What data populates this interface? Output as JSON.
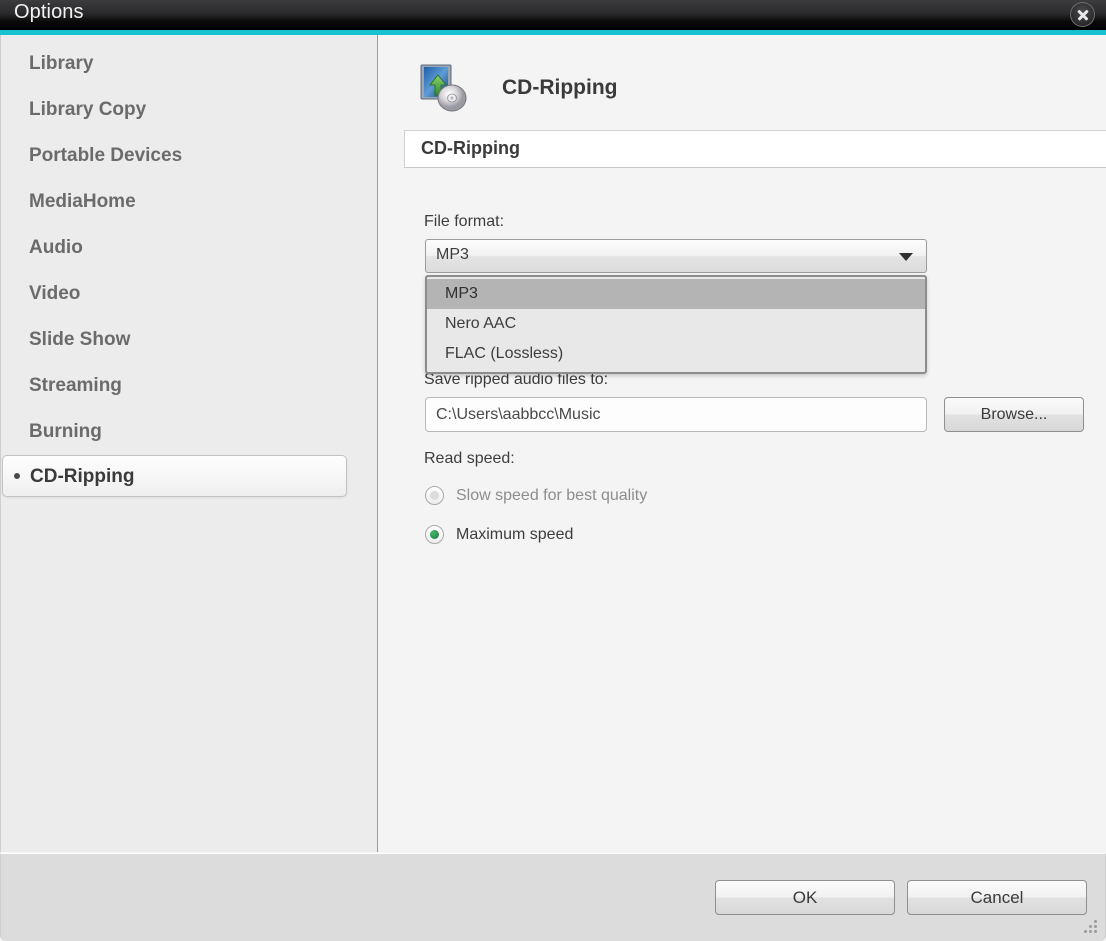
{
  "window": {
    "title": "Options",
    "close_icon": "close-icon",
    "accent_color": "#17c1cf"
  },
  "sidebar": {
    "items": [
      {
        "label": "Library",
        "selected": false
      },
      {
        "label": "Library Copy",
        "selected": false
      },
      {
        "label": "Portable Devices",
        "selected": false
      },
      {
        "label": "MediaHome",
        "selected": false
      },
      {
        "label": "Audio",
        "selected": false
      },
      {
        "label": "Video",
        "selected": false
      },
      {
        "label": "Slide Show",
        "selected": false
      },
      {
        "label": "Streaming",
        "selected": false
      },
      {
        "label": "Burning",
        "selected": false
      },
      {
        "label": "CD-Ripping",
        "selected": true
      }
    ]
  },
  "page": {
    "heading": "CD-Ripping",
    "heading_icon": "cd-ripping-icon",
    "groupbox_title": "CD-Ripping"
  },
  "file_format": {
    "label": "File format:",
    "selected": "MP3",
    "options": [
      "MP3",
      "Nero AAC",
      "FLAC (Lossless)"
    ],
    "highlighted_index": 0,
    "expanded": true,
    "arrow_icon": "chevron-down-icon"
  },
  "save_to": {
    "label": "Save ripped audio files to:",
    "value": "C:\\Users\\aabbcc\\Music",
    "browse_label": "Browse..."
  },
  "read_speed": {
    "label": "Read speed:",
    "options": [
      {
        "label": "Slow speed for best quality",
        "selected": false,
        "disabled": true
      },
      {
        "label": "Maximum speed",
        "selected": true,
        "disabled": false
      }
    ],
    "selected_color": "#1f8c46"
  },
  "footer": {
    "ok_label": "OK",
    "cancel_label": "Cancel",
    "grip_icon": "resize-grip-icon"
  }
}
